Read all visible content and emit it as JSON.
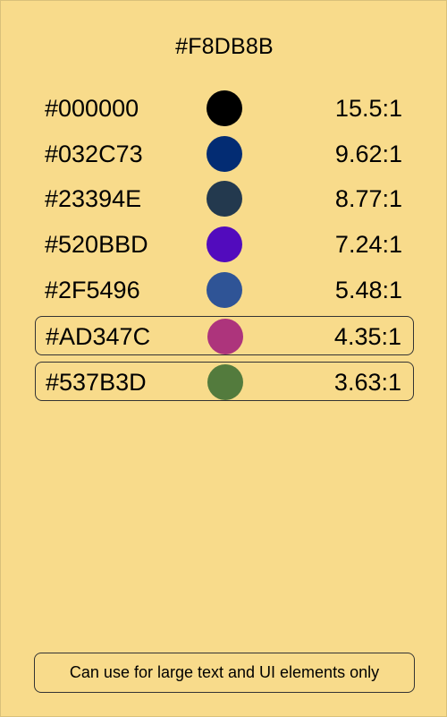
{
  "background": {
    "hex": "#F8DB8B",
    "color": "#F8DB8B"
  },
  "rows": [
    {
      "hex": "#000000",
      "ratio": "15.5:1",
      "swatch": "#000000"
    },
    {
      "hex": "#032C73",
      "ratio": "9.62:1",
      "swatch": "#032C73"
    },
    {
      "hex": "#23394E",
      "ratio": "8.77:1",
      "swatch": "#23394E"
    },
    {
      "hex": "#520BBD",
      "ratio": "7.24:1",
      "swatch": "#520BBD"
    },
    {
      "hex": "#2F5496",
      "ratio": "5.48:1",
      "swatch": "#2F5496"
    },
    {
      "hex": "#AD347C",
      "ratio": "4.35:1",
      "swatch": "#AD347C"
    },
    {
      "hex": "#537B3D",
      "ratio": "3.63:1",
      "swatch": "#537B3D"
    }
  ],
  "note": "Can use for large text and UI elements only"
}
